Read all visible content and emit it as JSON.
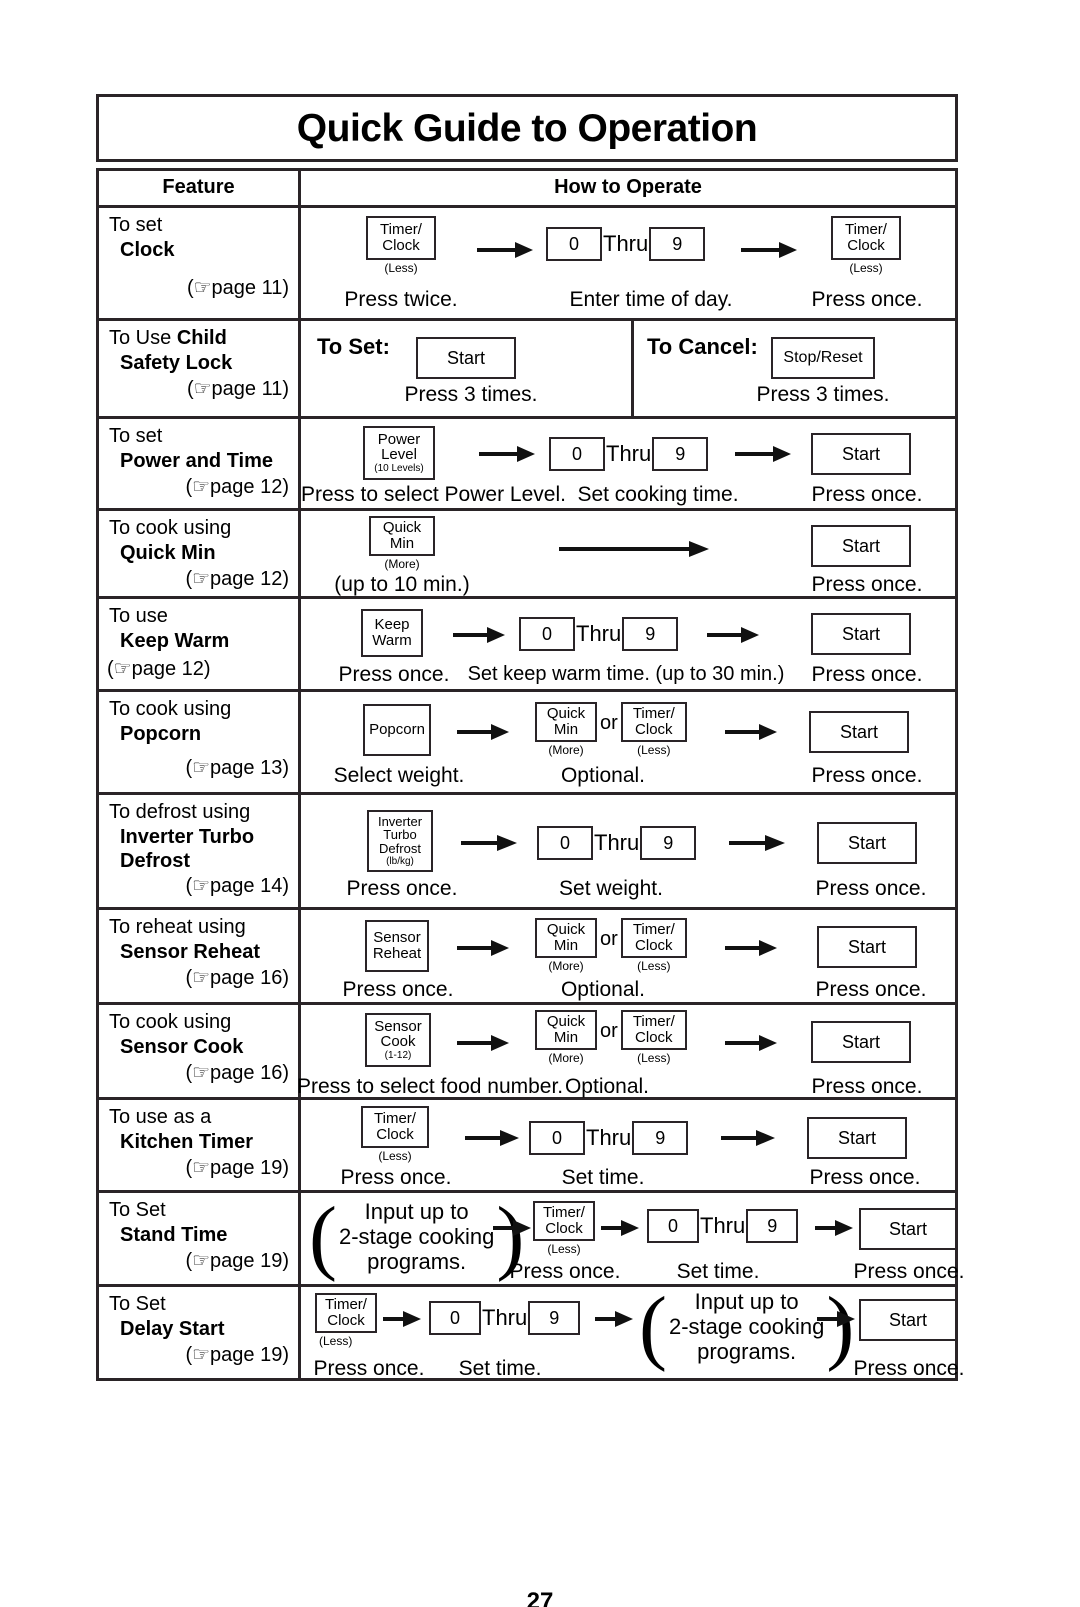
{
  "document": {
    "title": "Quick Guide to Operation",
    "page_number": "27"
  },
  "table": {
    "headers": {
      "feature": "Feature",
      "how_to_operate": "How to Operate"
    },
    "rows": [
      {
        "id": "clock",
        "feature": {
          "line1": "To set",
          "line2": "Clock",
          "page_ref": "(☞page 11)"
        },
        "steps": [
          {
            "key_label_top": "Timer/",
            "key_label_bottom": "Clock",
            "key_caption": "(Less)",
            "caption": "Press twice."
          },
          {
            "range_from": "0",
            "range_sep": "Thru",
            "range_to": "9",
            "caption": "Enter time of day."
          },
          {
            "key_label_top": "Timer/",
            "key_label_bottom": "Clock",
            "key_caption": "(Less)",
            "caption": "Press once."
          }
        ]
      },
      {
        "id": "child-safety-lock",
        "feature": {
          "line1_plain": "To Use ",
          "line1_bold": "Child",
          "line2": "Safety Lock",
          "page_ref": "(☞page 11)"
        },
        "steps": [
          {
            "label": "To Set:",
            "key": "Start",
            "caption": "Press 3 times."
          },
          {
            "label": "To Cancel:",
            "key": "Stop/Reset",
            "caption": "Press 3 times."
          }
        ]
      },
      {
        "id": "power-and-time",
        "feature": {
          "line1": "To set",
          "line2": "Power and Time",
          "page_ref": "(☞page 12)"
        },
        "steps": [
          {
            "key_label_top": "Power",
            "key_label_mid": "Level",
            "key_sub": "(10 Levels)",
            "caption": "Press to select Power Level."
          },
          {
            "range_from": "0",
            "range_sep": "Thru",
            "range_to": "9",
            "caption": "Set cooking time."
          },
          {
            "key": "Start",
            "caption": "Press once."
          }
        ]
      },
      {
        "id": "quick-min",
        "feature": {
          "line1": "To cook using",
          "line2": "Quick Min",
          "page_ref": "(☞page 12)"
        },
        "steps": [
          {
            "key_label_top": "Quick",
            "key_label_bottom": "Min",
            "key_caption": "(More)",
            "caption": "(up to 10 min.)"
          },
          {
            "key": "Start",
            "caption": "Press once."
          }
        ]
      },
      {
        "id": "keep-warm",
        "feature": {
          "line1": "To use",
          "line2": "Keep Warm",
          "page_ref": "(☞page 12)"
        },
        "steps": [
          {
            "key_label_top": "Keep",
            "key_label_bottom": "Warm",
            "caption": "Press once."
          },
          {
            "range_from": "0",
            "range_sep": "Thru",
            "range_to": "9",
            "caption": "Set keep warm time. (up to 30 min.)"
          },
          {
            "key": "Start",
            "caption": "Press once."
          }
        ]
      },
      {
        "id": "popcorn",
        "feature": {
          "line1": "To cook using",
          "line2": "Popcorn",
          "page_ref": "(☞page 13)"
        },
        "steps": [
          {
            "key": "Popcorn",
            "caption": "Select weight."
          },
          {
            "key_a_top": "Quick",
            "key_a_bottom": "Min",
            "key_a_caption": "(More)",
            "or": "or",
            "key_b_top": "Timer/",
            "key_b_bottom": "Clock",
            "key_b_caption": "(Less)",
            "caption": "Optional."
          },
          {
            "key": "Start",
            "caption": "Press once."
          }
        ]
      },
      {
        "id": "inverter-turbo-defrost",
        "feature": {
          "line1": "To defrost using",
          "line2": "Inverter Turbo",
          "line3": "Defrost",
          "page_ref": "(☞page 14)"
        },
        "steps": [
          {
            "key_label_top": "Inverter",
            "key_label_mid": "Turbo",
            "key_label_bottom": "Defrost",
            "key_sub": "(lb/kg)",
            "caption": "Press once."
          },
          {
            "range_from": "0",
            "range_sep": "Thru",
            "range_to": "9",
            "caption": "Set weight."
          },
          {
            "key": "Start",
            "caption": "Press once."
          }
        ]
      },
      {
        "id": "sensor-reheat",
        "feature": {
          "line1": "To reheat using",
          "line2": "Sensor Reheat",
          "page_ref": "(☞page 16)"
        },
        "steps": [
          {
            "key_label_top": "Sensor",
            "key_label_bottom": "Reheat",
            "caption": "Press once."
          },
          {
            "key_a_top": "Quick",
            "key_a_bottom": "Min",
            "key_a_caption": "(More)",
            "or": "or",
            "key_b_top": "Timer/",
            "key_b_bottom": "Clock",
            "key_b_caption": "(Less)",
            "caption": "Optional."
          },
          {
            "key": "Start",
            "caption": "Press once."
          }
        ]
      },
      {
        "id": "sensor-cook",
        "feature": {
          "line1": "To cook using",
          "line2": "Sensor Cook",
          "page_ref": "(☞page 16)"
        },
        "steps": [
          {
            "key_label_top": "Sensor",
            "key_label_bottom": "Cook",
            "key_sub": "(1-12)",
            "caption": "Press to select food number."
          },
          {
            "key_a_top": "Quick",
            "key_a_bottom": "Min",
            "key_a_caption": "(More)",
            "or": "or",
            "key_b_top": "Timer/",
            "key_b_bottom": "Clock",
            "key_b_caption": "(Less)",
            "caption": "Optional."
          },
          {
            "key": "Start",
            "caption": "Press once."
          }
        ]
      },
      {
        "id": "kitchen-timer",
        "feature": {
          "line1": "To use as a",
          "line2": "Kitchen Timer",
          "page_ref": "(☞page 19)"
        },
        "steps": [
          {
            "key_label_top": "Timer/",
            "key_label_bottom": "Clock",
            "key_caption": "(Less)",
            "caption": "Press once."
          },
          {
            "range_from": "0",
            "range_sep": "Thru",
            "range_to": "9",
            "caption": "Set time."
          },
          {
            "key": "Start",
            "caption": "Press once."
          }
        ]
      },
      {
        "id": "stand-time",
        "feature": {
          "line1": "To Set",
          "line2": "Stand Time",
          "page_ref": "(☞page 19)"
        },
        "steps": [
          {
            "paren_l1": "Input up to",
            "paren_l2": "2-stage cooking",
            "paren_l3": "programs."
          },
          {
            "key_label_top": "Timer/",
            "key_label_bottom": "Clock",
            "key_caption": "(Less)",
            "caption": "Press once."
          },
          {
            "range_from": "0",
            "range_sep": "Thru",
            "range_to": "9",
            "caption": "Set time."
          },
          {
            "key": "Start",
            "caption": "Press once."
          }
        ]
      },
      {
        "id": "delay-start",
        "feature": {
          "line1": "To Set",
          "line2": "Delay Start",
          "page_ref": "(☞page 19)"
        },
        "steps": [
          {
            "key_label_top": "Timer/",
            "key_label_bottom": "Clock",
            "key_caption": "(Less)",
            "caption": "Press once."
          },
          {
            "range_from": "0",
            "range_sep": "Thru",
            "range_to": "9",
            "caption": "Set time."
          },
          {
            "paren_l1": "Input up to",
            "paren_l2": "2-stage cooking",
            "paren_l3": "programs."
          },
          {
            "key": "Start",
            "caption": "Press once."
          }
        ]
      }
    ]
  },
  "colors": {
    "ink": "#2a2427",
    "paper": "#ffffff"
  }
}
